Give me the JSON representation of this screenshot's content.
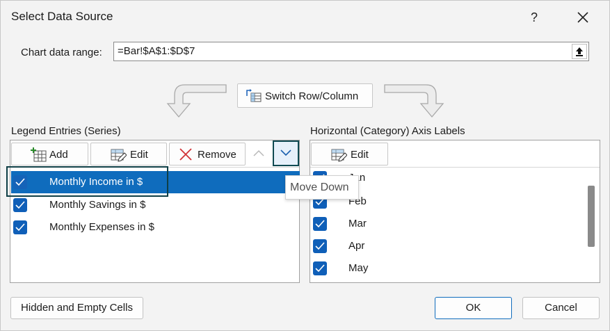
{
  "window": {
    "title": "Select Data Source",
    "help_label": "?",
    "close_icon": "close-icon"
  },
  "range": {
    "label": "Chart data range:",
    "value": "=Bar!$A$1:$D$7",
    "collapse_icon": "collapse-dialog-icon"
  },
  "switch_button": {
    "label": "Switch Row/Column",
    "icon": "switch-row-column-icon"
  },
  "series_panel": {
    "label": "Legend Entries (Series)",
    "add_label": "Add",
    "edit_label": "Edit",
    "remove_label": "Remove",
    "move_up_icon": "chevron-up-icon",
    "move_down_icon": "chevron-down-icon",
    "items": [
      {
        "label": "Monthly Income in $",
        "checked": true,
        "selected": true
      },
      {
        "label": "Monthly Savings in $",
        "checked": true,
        "selected": false
      },
      {
        "label": "Monthly Expenses in $",
        "checked": true,
        "selected": false
      }
    ]
  },
  "tooltip": {
    "text": "Move Down"
  },
  "category_panel": {
    "label": "Horizontal (Category) Axis Labels",
    "edit_label": "Edit",
    "items": [
      {
        "label": "Jan",
        "checked": true
      },
      {
        "label": "Feb",
        "checked": true
      },
      {
        "label": "Mar",
        "checked": true
      },
      {
        "label": "Apr",
        "checked": true
      },
      {
        "label": "May",
        "checked": true
      }
    ]
  },
  "footer": {
    "hidden_cells_label": "Hidden and Empty Cells",
    "ok_label": "OK",
    "cancel_label": "Cancel"
  },
  "colors": {
    "accent": "#0f6cbd",
    "focus_ring": "#0f3f46",
    "remove_icon": "#d13438"
  }
}
